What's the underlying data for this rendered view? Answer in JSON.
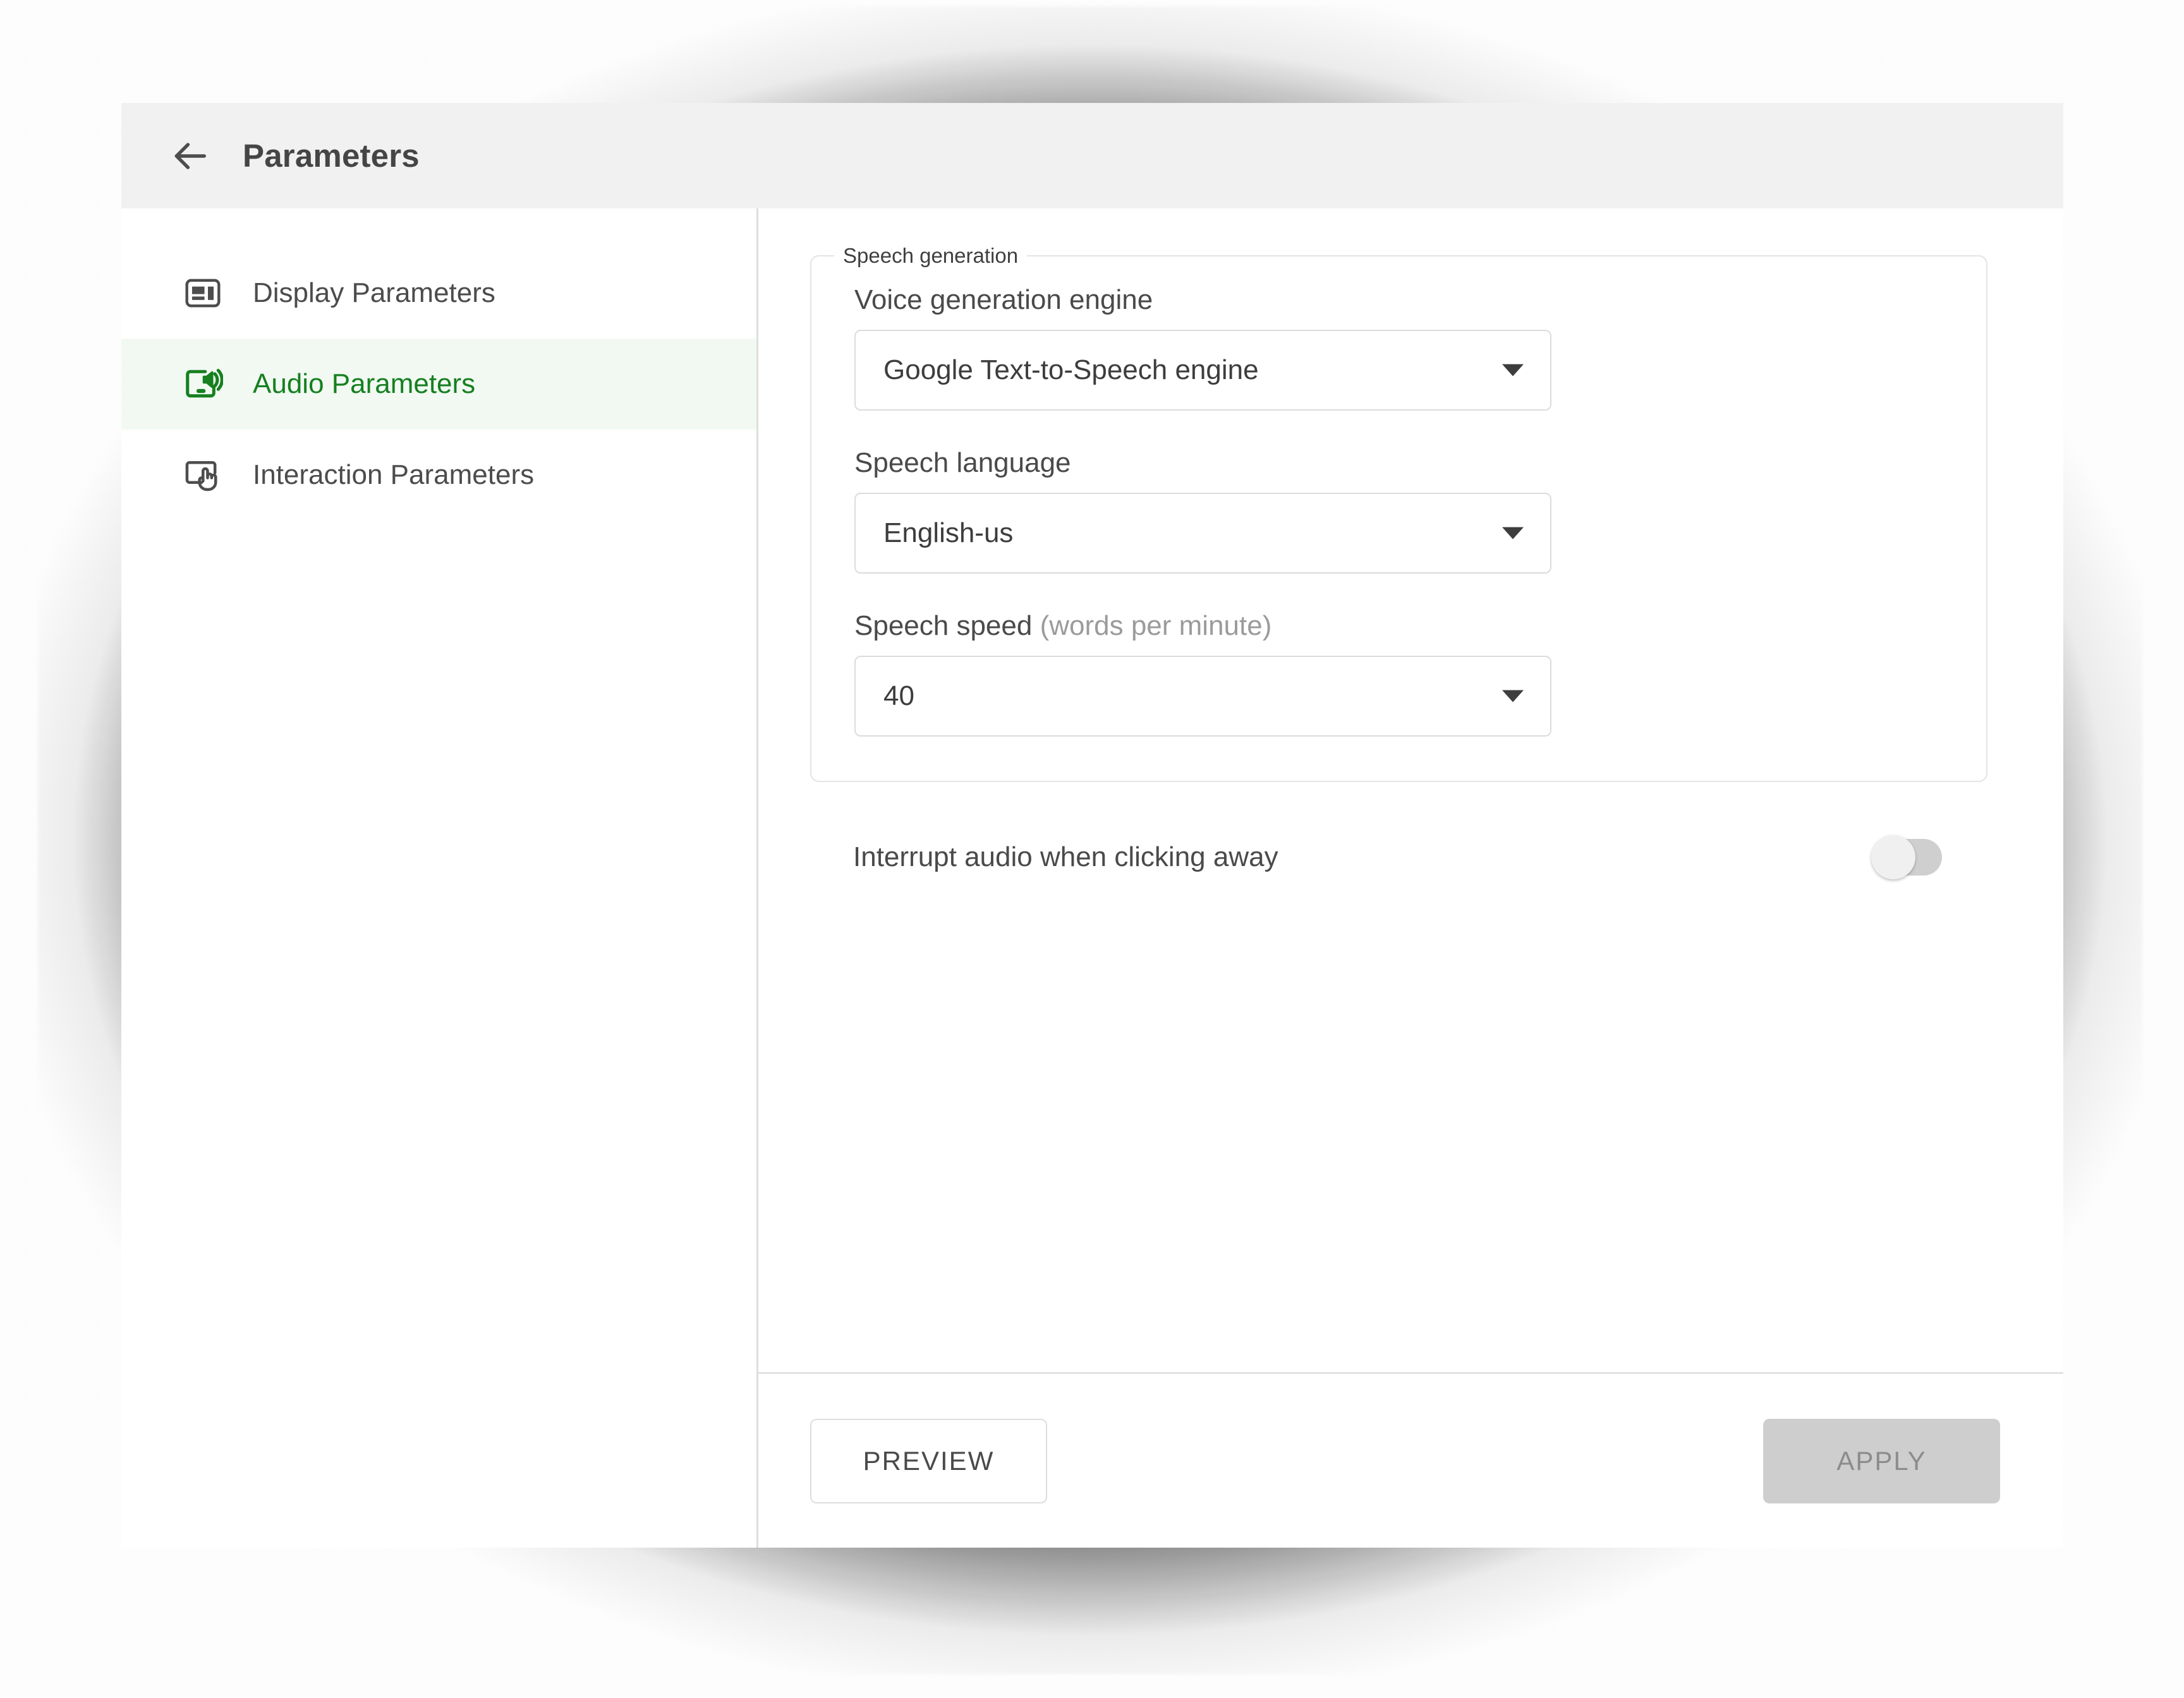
{
  "window": {
    "title": "Parameters",
    "back_icon": "arrow-left-icon"
  },
  "theme": {
    "accent_green": "#16801f",
    "selected_row_bg": "#f2f9f3",
    "app_bar_bg": "#f1f1f1",
    "text_primary": "#4a4a4a",
    "text_muted": "#9b9b9b",
    "border": "#dedede",
    "disabled_bg": "#cecece",
    "disabled_text": "#8c8c8c"
  },
  "sidebar": {
    "items": [
      {
        "label": "Display Parameters",
        "icon": "display-layout-icon",
        "selected": false
      },
      {
        "label": "Audio Parameters",
        "icon": "screen-speaker-icon",
        "selected": true
      },
      {
        "label": "Interaction Parameters",
        "icon": "screen-touch-hand-icon",
        "selected": false
      }
    ]
  },
  "content": {
    "group": {
      "legend": "Speech generation",
      "fields": [
        {
          "label": "Voice generation engine",
          "hint": "",
          "value": "Google Text-to-Speech engine",
          "caret_icon": "chevron-down-icon"
        },
        {
          "label": "Speech language",
          "hint": "",
          "value": "English-us",
          "caret_icon": "chevron-down-icon"
        },
        {
          "label": "Speech speed",
          "hint": "(words per minute)",
          "value": "40",
          "caret_icon": "chevron-down-icon"
        }
      ]
    },
    "toggle": {
      "label": "Interrupt audio when clicking away",
      "state": "off"
    }
  },
  "footer": {
    "preview_label": "PREVIEW",
    "apply_label": "APPLY",
    "apply_disabled": true
  }
}
